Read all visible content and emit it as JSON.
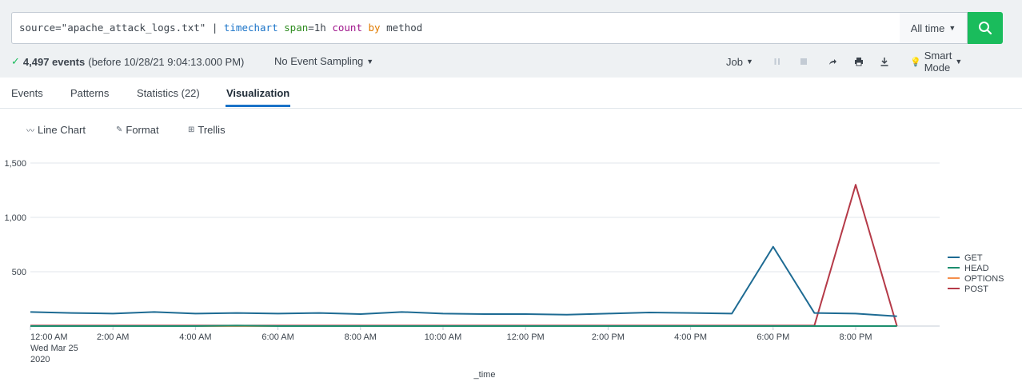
{
  "search": {
    "query_parts": [
      {
        "text": "source=\"apache_attack_logs.txt\" | ",
        "kind": "plain"
      },
      {
        "text": "timechart",
        "kind": "cmd"
      },
      {
        "text": " ",
        "kind": "plain"
      },
      {
        "text": "span",
        "kind": "arg"
      },
      {
        "text": "=1h ",
        "kind": "plain"
      },
      {
        "text": "count",
        "kind": "fn"
      },
      {
        "text": " ",
        "kind": "plain"
      },
      {
        "text": "by",
        "kind": "kw"
      },
      {
        "text": " method",
        "kind": "plain"
      }
    ],
    "time_range": "All time",
    "search_icon": "magnifier-icon"
  },
  "status": {
    "event_count": "4,497 events",
    "before_text": "(before 10/28/21 9:04:13.000 PM)",
    "sampling": "No Event Sampling"
  },
  "job": {
    "job_label": "Job",
    "mode_label": "Smart Mode"
  },
  "tabs": [
    {
      "label": "Events"
    },
    {
      "label": "Patterns"
    },
    {
      "label": "Statistics (22)"
    },
    {
      "label": "Visualization"
    }
  ],
  "viz_toolbar": {
    "chart_type": "Line Chart",
    "format": "Format",
    "trellis": "Trellis"
  },
  "chart_data": {
    "type": "line",
    "xlabel": "_time",
    "ylabel": "",
    "ylim": [
      0,
      1500
    ],
    "y_ticks": [
      "1,500",
      "1,000",
      "500"
    ],
    "y_tick_values": [
      1500,
      1000,
      500
    ],
    "x_tick_labels": [
      "12:00 AM",
      "2:00 AM",
      "4:00 AM",
      "6:00 AM",
      "8:00 AM",
      "10:00 AM",
      "12:00 PM",
      "2:00 PM",
      "4:00 PM",
      "6:00 PM",
      "8:00 PM"
    ],
    "x_tick_hours": [
      0,
      2,
      4,
      6,
      8,
      10,
      12,
      14,
      16,
      18,
      20
    ],
    "x_first_sublabel": [
      "Wed Mar 25",
      "2020"
    ],
    "x_hours": [
      0,
      1,
      2,
      3,
      4,
      5,
      6,
      7,
      8,
      9,
      10,
      11,
      12,
      13,
      14,
      15,
      16,
      17,
      18,
      19,
      20,
      21
    ],
    "legend_position": "right",
    "grid": true,
    "series": [
      {
        "name": "GET",
        "color": "#1e6b93",
        "values": [
          130,
          120,
          115,
          130,
          115,
          120,
          115,
          120,
          110,
          130,
          115,
          110,
          110,
          105,
          115,
          125,
          120,
          115,
          730,
          120,
          115,
          90
        ]
      },
      {
        "name": "HEAD",
        "color": "#1c8e6e",
        "values": [
          0,
          0,
          0,
          0,
          0,
          5,
          0,
          0,
          0,
          0,
          0,
          0,
          0,
          0,
          0,
          0,
          0,
          0,
          0,
          0,
          0,
          0
        ]
      },
      {
        "name": "OPTIONS",
        "color": "#f58f4c",
        "values": [
          0,
          0,
          0,
          0,
          0,
          0,
          0,
          0,
          0,
          0,
          0,
          0,
          0,
          0,
          0,
          0,
          0,
          0,
          0,
          0,
          0,
          0
        ]
      },
      {
        "name": "POST",
        "color": "#b53a48",
        "values": [
          5,
          5,
          5,
          5,
          5,
          5,
          5,
          5,
          5,
          5,
          5,
          5,
          5,
          5,
          5,
          5,
          5,
          5,
          5,
          5,
          1300,
          0
        ]
      }
    ]
  }
}
